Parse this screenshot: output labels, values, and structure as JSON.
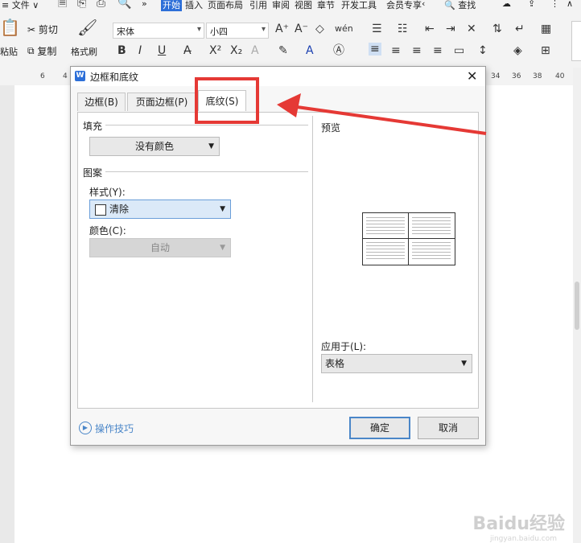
{
  "menubar": {
    "file_label": "文件",
    "tabs": [
      "开始",
      "插入",
      "页面布局",
      "引用",
      "审阅",
      "视图",
      "章节",
      "开发工具",
      "会员专享"
    ],
    "search_label": "查找"
  },
  "toolbar": {
    "paste_label": "粘贴",
    "cut_label": "剪切",
    "copy_label": "复制",
    "format_painter_label": "格式刷",
    "font_name": "宋体",
    "font_size": "小四"
  },
  "ruler": {
    "ticks": [
      "6",
      "4",
      "34",
      "36",
      "38",
      "40"
    ]
  },
  "dialog": {
    "title": "边框和底纹",
    "tabs": [
      {
        "label": "边框(B)"
      },
      {
        "label": "页面边框(P)"
      },
      {
        "label": "底纹(S)"
      }
    ],
    "fill": {
      "label": "填充",
      "value": "没有颜色"
    },
    "pattern": {
      "label": "图案",
      "style_label": "样式(Y):",
      "style_value": "清除",
      "color_label": "颜色(C):",
      "color_value": "自动"
    },
    "preview_label": "预览",
    "apply_to_label": "应用于(L):",
    "apply_to_value": "表格",
    "tips_label": "操作技巧",
    "ok_label": "确定",
    "cancel_label": "取消"
  },
  "watermark": {
    "text": "Baidu经验",
    "subtext": "jingyan.baidu.com"
  },
  "colors": {
    "annotation_red": "#e53935",
    "primary_border": "#4a86c8",
    "active_tab_highlight": "#2d6fd8"
  }
}
